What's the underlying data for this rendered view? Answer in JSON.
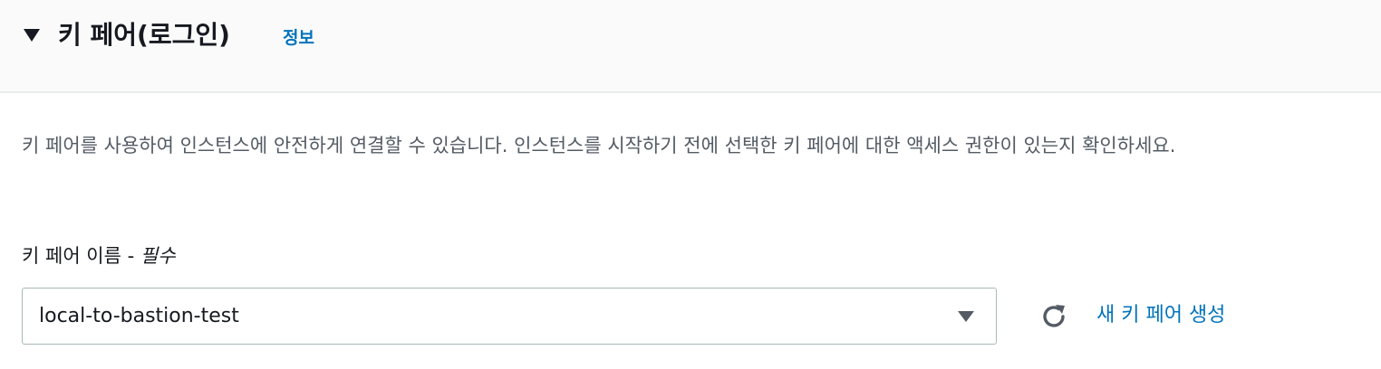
{
  "section": {
    "title": "키 페어(로그인)",
    "info_link": "정보",
    "expanded": true,
    "toggle_icon": "caret-down-icon"
  },
  "description": "키 페어를 사용하여 인스턴스에 안전하게 연결할 수 있습니다. 인스턴스를 시작하기 전에 선택한 키 페어에 대한 액세스 권한이 있는지 확인하세요.",
  "key_pair_field": {
    "label": "키 페어 이름 - ",
    "required": "필수",
    "selected_value": "local-to-bastion-test",
    "dropdown_icon": "caret-down-icon"
  },
  "actions": {
    "refresh_icon": "refresh-icon",
    "create_label": "새 키 페어 생성"
  },
  "colors": {
    "link": "#0073bb",
    "header_bg": "#fafafa",
    "text": "#16191f",
    "secondary_text": "#545b64",
    "border": "#aab7b8"
  }
}
